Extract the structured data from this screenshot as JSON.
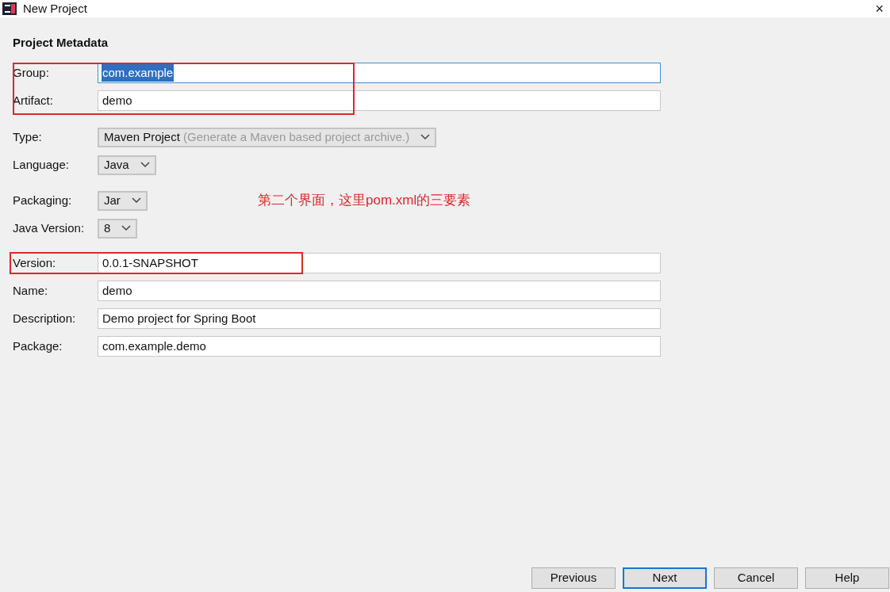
{
  "window": {
    "title": "New Project",
    "close": "×"
  },
  "heading": "Project Metadata",
  "fields": [
    {
      "kind": "text",
      "label": "Group:",
      "value": "com.example",
      "focused": true,
      "text_selected": true
    },
    {
      "kind": "text",
      "label": "Artifact:",
      "value": "demo",
      "focused": false,
      "text_selected": false
    },
    {
      "kind": "dropdown",
      "label": "Type:",
      "value": "Maven Project",
      "note": "(Generate a Maven based project archive.)"
    },
    {
      "kind": "dropdown",
      "label": "Language:",
      "value": "Java"
    },
    {
      "kind": "dropdown",
      "label": "Packaging:",
      "value": "Jar"
    },
    {
      "kind": "dropdown",
      "label": "Java Version:",
      "value": "8"
    },
    {
      "kind": "text",
      "label": "Version:",
      "value": "0.0.1-SNAPSHOT",
      "focused": false,
      "text_selected": false
    },
    {
      "kind": "text",
      "label": "Name:",
      "value": "demo",
      "focused": false,
      "text_selected": false
    },
    {
      "kind": "text",
      "label": "Description:",
      "value": "Demo project for Spring Boot",
      "focused": false,
      "text_selected": false
    },
    {
      "kind": "text",
      "label": "Package:",
      "value": "com.example.demo",
      "focused": false,
      "text_selected": false
    }
  ],
  "annotation": "第二个界面，这里pom.xml的三要素",
  "buttons": [
    {
      "label": "Previous",
      "default": false
    },
    {
      "label": "Next",
      "default": true
    },
    {
      "label": "Cancel",
      "default": false
    },
    {
      "label": "Help",
      "default": false
    }
  ]
}
